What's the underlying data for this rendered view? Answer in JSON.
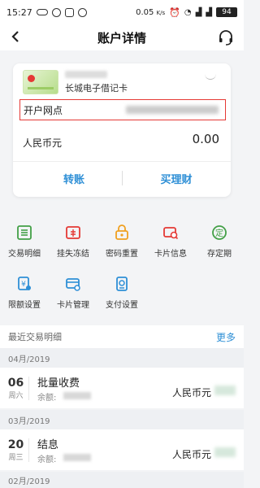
{
  "status_bar": {
    "time": "15:27",
    "network_speed": "0.05",
    "network_unit": "K/s",
    "battery": "94"
  },
  "header": {
    "title": "账户详情"
  },
  "card": {
    "name": "长城电子借记卡",
    "branch_label": "开户网点",
    "currency_label": "人民币元",
    "balance": "0.00",
    "transfer_label": "转账",
    "wealth_label": "买理财"
  },
  "functions": [
    {
      "label": "交易明细",
      "icon": "list-icon"
    },
    {
      "label": "挂失冻结",
      "icon": "lock-card-icon"
    },
    {
      "label": "密码重置",
      "icon": "key-lock-icon"
    },
    {
      "label": "卡片信息",
      "icon": "card-info-icon"
    },
    {
      "label": "存定期",
      "icon": "fixed-deposit-icon"
    },
    {
      "label": "限额设置",
      "icon": "limit-settings-icon"
    },
    {
      "label": "卡片管理",
      "icon": "card-manage-icon"
    },
    {
      "label": "支付设置",
      "icon": "payment-settings-icon"
    }
  ],
  "recent": {
    "title": "最近交易明细",
    "more": "更多",
    "groups": [
      {
        "month": "04月/2019",
        "day": "06",
        "weekday": "周六",
        "title": "批量收费",
        "sub": "余额:",
        "currency": "人民币元"
      },
      {
        "month": "03月/2019",
        "day": "20",
        "weekday": "周三",
        "title": "结息",
        "sub": "余额:",
        "currency": "人民币元"
      },
      {
        "month": "02月/2019"
      }
    ]
  },
  "colors": {
    "accent": "#2e8fd6",
    "highlight_box": "#e53935",
    "icon_red": "#e53935",
    "icon_green": "#43a047",
    "icon_blue": "#2e8fd6",
    "icon_orange": "#f0a020"
  }
}
